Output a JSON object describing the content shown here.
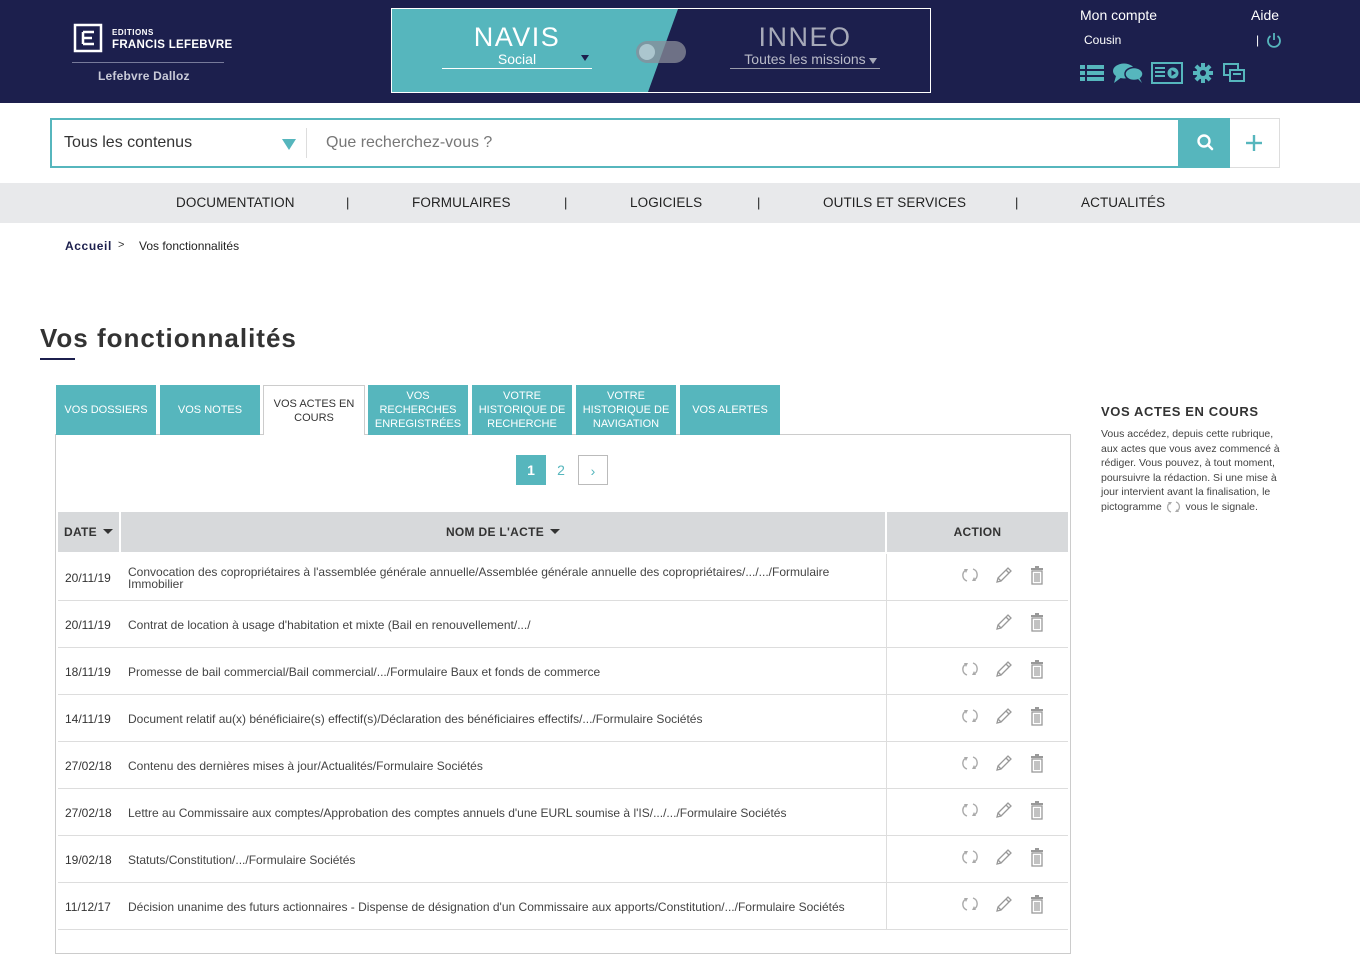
{
  "header": {
    "logo": {
      "editions": "EDITIONS",
      "name": "FRANCIS LEFEBVRE",
      "sub": "Lefebvre Dalloz"
    },
    "navis": {
      "title": "NAVIS",
      "subtitle": "Social"
    },
    "inneo": {
      "title": "INNEO",
      "subtitle": "Toutes les missions"
    },
    "account_label": "Mon compte",
    "help_label": "Aide",
    "user_name": "Cousin",
    "separator": "|",
    "icons": [
      "list-icon",
      "chat-icon",
      "video-icon",
      "gear-icon",
      "windows-icon"
    ]
  },
  "search": {
    "scope": "Tous les contenus",
    "placeholder": "Que recherchez-vous ?",
    "value": ""
  },
  "nav": {
    "items": [
      "DOCUMENTATION",
      "FORMULAIRES",
      "LOGICIELS",
      "OUTILS ET SERVICES",
      "ACTUALITÉS"
    ],
    "separator": "|"
  },
  "breadcrumb": {
    "home": "Accueil",
    "arrow": ">",
    "current": "Vos fonctionnalités"
  },
  "page_title": "Vos fonctionnalités",
  "tabs": [
    {
      "label": "VOS DOSSIERS"
    },
    {
      "label": "VOS NOTES"
    },
    {
      "label": "VOS ACTES EN COURS",
      "active": true
    },
    {
      "label": "VOS RECHERCHES ENREGISTRÉES"
    },
    {
      "label": "VOTRE HISTORIQUE DE RECHERCHE"
    },
    {
      "label": "VOTRE HISTORIQUE DE NAVIGATION"
    },
    {
      "label": "VOS ALERTES"
    }
  ],
  "pagination": {
    "current": "1",
    "next_page": "2",
    "next_arrow": "›"
  },
  "table": {
    "headers": {
      "date": "DATE",
      "name": "NOM DE L'ACTE",
      "action": "ACTION"
    },
    "rows": [
      {
        "date": "20/11/19",
        "name": "Convocation des copropriétaires à l'assemblée générale annuelle/Assemblée générale annuelle des copropriétaires/.../.../Formulaire Immobilier",
        "update": true
      },
      {
        "date": "20/11/19",
        "name": "Contrat de location à usage d'habitation et mixte (Bail en renouvellement/.../",
        "update": false
      },
      {
        "date": "18/11/19",
        "name": "Promesse de bail commercial/Bail commercial/.../Formulaire Baux et fonds de commerce",
        "update": true
      },
      {
        "date": "14/11/19",
        "name": "Document relatif au(x) bénéficiaire(s) effectif(s)/Déclaration des bénéficiaires effectifs/.../Formulaire Sociétés",
        "update": true
      },
      {
        "date": "27/02/18",
        "name": "Contenu des dernières mises à jour/Actualités/Formulaire Sociétés",
        "update": true
      },
      {
        "date": "27/02/18",
        "name": "Lettre au Commissaire aux comptes/Approbation des comptes annuels d'une EURL soumise à l'IS/.../.../Formulaire Sociétés",
        "update": true
      },
      {
        "date": "19/02/18",
        "name": "Statuts/Constitution/.../Formulaire Sociétés",
        "update": true
      },
      {
        "date": "11/12/17",
        "name": "Décision unanime des futurs actionnaires - Dispense de désignation d'un Commissaire aux apports/Constitution/.../Formulaire Sociétés",
        "update": true
      }
    ]
  },
  "side": {
    "title": "VOS ACTES EN COURS",
    "text_before": "Vous accédez, depuis cette rubrique, aux actes que vous avez commencé à rédiger. Vous pouvez, à tout moment, poursuivre la rédaction. Si une mise à jour intervient avant la finalisation, le pictogramme",
    "text_after": "vous le signale."
  },
  "colors": {
    "navy": "#1c1f4d",
    "teal": "#56b6bd",
    "nav_bg": "#e8e9eb",
    "header_cell": "#d7d9db"
  }
}
